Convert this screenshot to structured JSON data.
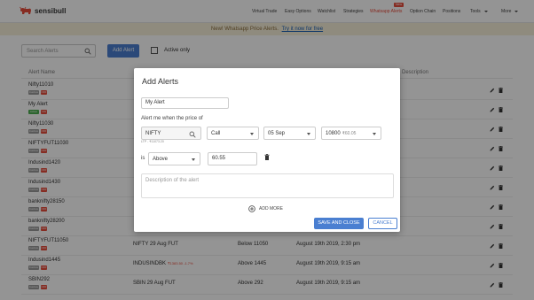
{
  "nav": {
    "brand": "sensibull",
    "items": [
      {
        "label": "Virtual Trade",
        "active": false
      },
      {
        "label": "Easy Options",
        "active": false
      },
      {
        "label": "Watchlist",
        "active": false
      },
      {
        "label": "Strategies",
        "active": false
      },
      {
        "label": "Whatsapp Alerts",
        "active": true
      },
      {
        "label": "Option Chain",
        "active": false
      },
      {
        "label": "Positions",
        "active": false
      },
      {
        "label": "Tools",
        "active": false
      },
      {
        "label": "More",
        "active": false
      }
    ],
    "new_badge": "New"
  },
  "banner": {
    "text": "New! Whatsapp Price Alerts.",
    "link": "Try it now for free"
  },
  "toolbar": {
    "search_placeholder": "Search Alerts",
    "add_button": "Add Alert",
    "active_only_label": "Active only"
  },
  "table": {
    "headers": {
      "name": "Alert Name",
      "description": "Description"
    },
    "rows": [
      {
        "name": "Nifty11010",
        "status": "Inactive",
        "tag": "OFF",
        "instrument": "",
        "sub": "",
        "condition": "",
        "date": ""
      },
      {
        "name": "My Alert",
        "status": "Active",
        "tag": "ON",
        "instrument": "",
        "sub": "",
        "condition": "",
        "date": ""
      },
      {
        "name": "Nifty11030",
        "status": "Inactive",
        "tag": "OFF",
        "instrument": "",
        "sub": "",
        "condition": "",
        "date": ""
      },
      {
        "name": "NIFTYFUT11030",
        "status": "Inactive",
        "tag": "OFF",
        "instrument": "",
        "sub": "",
        "condition": "",
        "date": ""
      },
      {
        "name": "Indusind1420",
        "status": "Inactive",
        "tag": "OFF",
        "instrument": "",
        "sub": "",
        "condition": "",
        "date": ""
      },
      {
        "name": "Indusind1430",
        "status": "Inactive",
        "tag": "OFF",
        "instrument": "",
        "sub": "",
        "condition": "",
        "date": ""
      },
      {
        "name": "banknifty28150",
        "status": "Inactive",
        "tag": "OFF",
        "instrument": "",
        "sub": "",
        "condition": "",
        "date": ""
      },
      {
        "name": "banknifty28200",
        "status": "Inactive",
        "tag": "OFF",
        "instrument": "",
        "sub": "",
        "condition": "",
        "date": ""
      },
      {
        "name": "NIFTYFUT11050",
        "status": "Inactive",
        "tag": "OFF",
        "instrument": "NIFTY 29 Aug FUT",
        "sub": "",
        "condition": "Below 11050",
        "date": "August 19th 2019, 2:30 pm"
      },
      {
        "name": "Indusind1445",
        "status": "Inactive",
        "tag": "OFF",
        "instrument": "INDUSINDBK",
        "sub": "₹1383.50 -1.7%",
        "condition": "Above 1445",
        "date": "August 19th 2019, 9:15 am"
      },
      {
        "name": "SBIN292",
        "status": "Inactive",
        "tag": "OFF",
        "instrument": "SBIN 29 Aug FUT",
        "sub": "",
        "condition": "Above 292",
        "date": "August 19th 2019, 9:15 am"
      }
    ]
  },
  "modal": {
    "title": "Add Alerts",
    "alert_name_value": "My Alert",
    "price_label": "Alert me when the price of",
    "instrument_value": "NIFTY",
    "instrument_ltp": "LTP - ₹11073.20",
    "option_type": "Call",
    "expiry": "05 Sep",
    "strike": "10800",
    "strike_price": "₹60.05",
    "is_label": "is",
    "condition": "Above",
    "value": "60.55",
    "description_placeholder": "Description of the alert",
    "add_more": "ADD MORE",
    "save_button": "SAVE AND CLOSE",
    "cancel_button": "CANCEL"
  }
}
